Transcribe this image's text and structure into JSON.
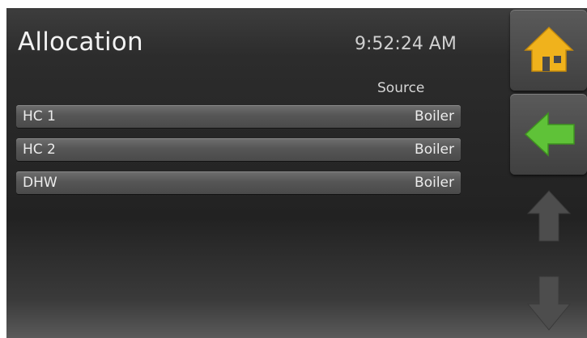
{
  "header": {
    "title": "Allocation",
    "time": "9:52:24 AM"
  },
  "table": {
    "column_header": "Source",
    "rows": [
      {
        "name": "HC 1",
        "value": "Boiler"
      },
      {
        "name": "HC 2",
        "value": "Boiler"
      },
      {
        "name": "DHW",
        "value": "Boiler"
      }
    ]
  },
  "sidebar": {
    "buttons": [
      {
        "icon": "home-icon"
      },
      {
        "icon": "back-arrow-icon"
      },
      {
        "icon": "scroll-up-icon"
      },
      {
        "icon": "scroll-down-icon"
      }
    ]
  },
  "colors": {
    "home_icon": "#f0b21c",
    "back_icon": "#5fc238",
    "disabled_arrow": "#4d4d4d"
  }
}
